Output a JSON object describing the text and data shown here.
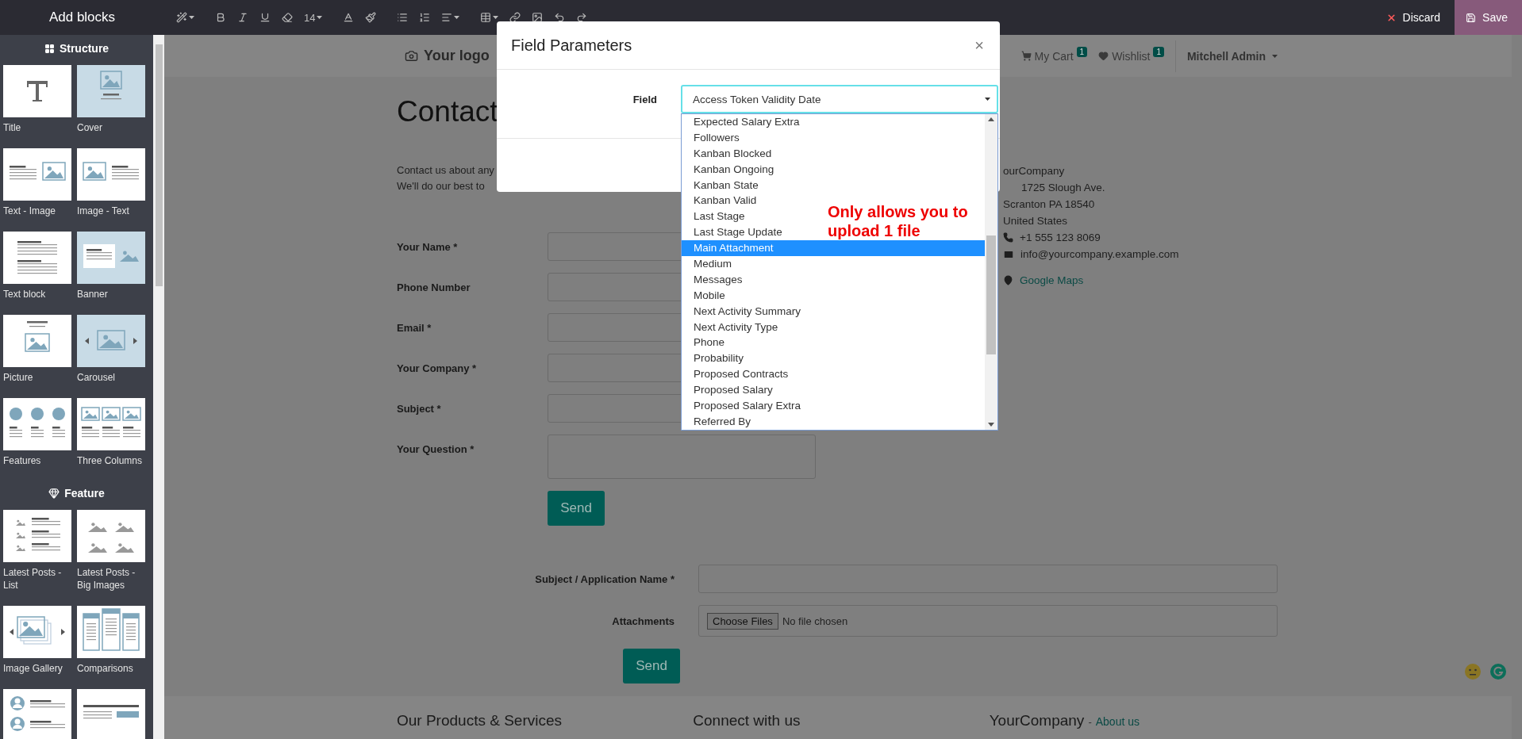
{
  "editor": {
    "title": "Add blocks",
    "font_size": "14",
    "actions": [
      {
        "kind": "discard",
        "label": "Discard"
      },
      {
        "kind": "save",
        "label": "Save"
      }
    ]
  },
  "sidebar": {
    "sections": [
      {
        "title": "Structure",
        "blocks": [
          {
            "kind": "title",
            "label": "Title"
          },
          {
            "kind": "cover",
            "label": "Cover"
          },
          {
            "kind": "text_image",
            "label": "Text - Image"
          },
          {
            "kind": "image_text",
            "label": "Image - Text"
          },
          {
            "kind": "text_block",
            "label": "Text block"
          },
          {
            "kind": "banner",
            "label": "Banner"
          },
          {
            "kind": "picture",
            "label": "Picture"
          },
          {
            "kind": "carousel",
            "label": "Carousel"
          },
          {
            "kind": "features",
            "label": "Features"
          },
          {
            "kind": "three_columns",
            "label": "Three Columns"
          }
        ]
      },
      {
        "title": "Feature",
        "blocks": [
          {
            "kind": "posts_list",
            "label": "Latest Posts - List"
          },
          {
            "kind": "posts_big",
            "label": "Latest Posts - Big Images"
          },
          {
            "kind": "gallery",
            "label": "Image Gallery"
          },
          {
            "kind": "comparisons",
            "label": "Comparisons"
          },
          {
            "kind": "team"
          },
          {
            "kind": "cta"
          }
        ]
      }
    ]
  },
  "page": {
    "header": {
      "logo": "Your logo",
      "links": [
        {
          "label": "My Cart",
          "badge": "1"
        },
        {
          "label": "Wishlist",
          "badge": "1"
        }
      ],
      "user": "Mitchell Admin"
    },
    "heading": "Contact",
    "intro": [
      "Contact us about any",
      "We'll do our best to"
    ],
    "contact_form": {
      "fields": [
        {
          "label": "Your Name *",
          "kind": "input"
        },
        {
          "label": "Phone Number",
          "kind": "input"
        },
        {
          "label": "Email *",
          "kind": "input"
        },
        {
          "label": "Your Company *",
          "kind": "input"
        },
        {
          "label": "Subject *",
          "kind": "input"
        },
        {
          "label": "Your Question *",
          "kind": "textarea"
        }
      ],
      "submit": "Send"
    },
    "address": [
      {
        "text": "ourCompany",
        "link": false
      },
      {
        "text": "1725 Slough Ave.",
        "link": false
      },
      {
        "text": "Scranton PA 18540",
        "link": false
      },
      {
        "text": "United States",
        "link": false
      },
      {
        "text": "+1 555 123 8069",
        "link": false
      },
      {
        "text": "info@yourcompany.example.com",
        "link": false
      },
      {
        "text": "Google Maps",
        "link": true
      }
    ],
    "application_form": {
      "fields": [
        {
          "label": "Subject / Application Name *",
          "kind": "input"
        },
        {
          "label": "Attachments",
          "kind": "file",
          "button": "Choose Files",
          "status": "No file chosen"
        }
      ],
      "submit": "Send"
    },
    "footer": {
      "columns": [
        {
          "title": "Our Products & Services"
        },
        {
          "title": "Connect with us"
        },
        {
          "title": "YourCompany",
          "separator": "-",
          "link": "About us"
        }
      ]
    }
  },
  "modal": {
    "title": "Field Parameters",
    "close": "×",
    "field_label": "Field",
    "value": "Access Token Validity Date",
    "options": [
      {
        "label": "Expected Salary Extra",
        "selected": false
      },
      {
        "label": "Followers",
        "selected": false
      },
      {
        "label": "Kanban Blocked",
        "selected": false
      },
      {
        "label": "Kanban Ongoing",
        "selected": false
      },
      {
        "label": "Kanban State",
        "selected": false
      },
      {
        "label": "Kanban Valid",
        "selected": false
      },
      {
        "label": "Last Stage",
        "selected": false
      },
      {
        "label": "Last Stage Update",
        "selected": false
      },
      {
        "label": "Main Attachment",
        "selected": true
      },
      {
        "label": "Medium",
        "selected": false
      },
      {
        "label": "Messages",
        "selected": false
      },
      {
        "label": "Mobile",
        "selected": false
      },
      {
        "label": "Next Activity Summary",
        "selected": false
      },
      {
        "label": "Next Activity Type",
        "selected": false
      },
      {
        "label": "Phone",
        "selected": false
      },
      {
        "label": "Probability",
        "selected": false
      },
      {
        "label": "Proposed Contracts",
        "selected": false
      },
      {
        "label": "Proposed Salary",
        "selected": false
      },
      {
        "label": "Proposed Salary Extra",
        "selected": false
      },
      {
        "label": "Referred By",
        "selected": false
      }
    ]
  },
  "annotation": "Only allows you to upload 1 file"
}
